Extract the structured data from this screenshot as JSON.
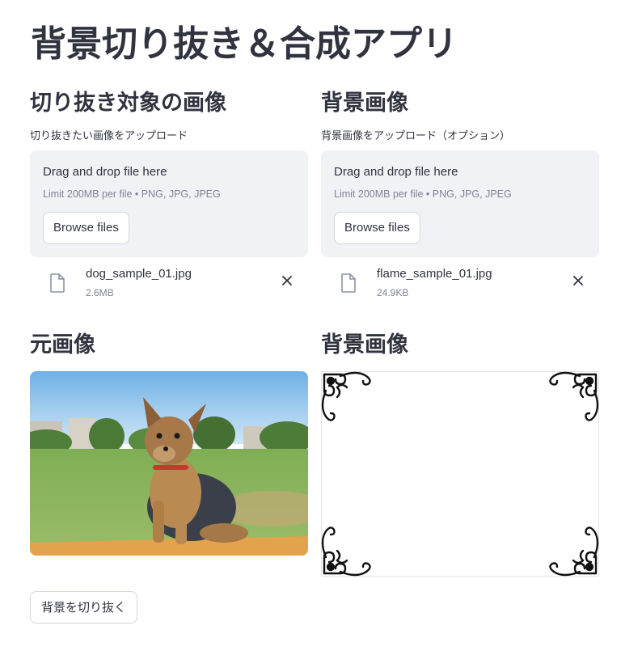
{
  "app": {
    "title": "背景切り抜き＆合成アプリ"
  },
  "cutout": {
    "heading": "切り抜き対象の画像",
    "uploader": {
      "label": "切り抜きたい画像をアップロード",
      "drop_text": "Drag and drop file here",
      "limit_text": "Limit 200MB per file • PNG, JPG, JPEG",
      "browse_label": "Browse files"
    },
    "file": {
      "name": "dog_sample_01.jpg",
      "size": "2.6MB",
      "icon": "file-icon",
      "remove_icon": "close-icon"
    }
  },
  "background": {
    "heading": "背景画像",
    "uploader": {
      "label": "背景画像をアップロード（オプション）",
      "drop_text": "Drag and drop file here",
      "limit_text": "Limit 200MB per file • PNG, JPG, JPEG",
      "browse_label": "Browse files"
    },
    "file": {
      "name": "flame_sample_01.jpg",
      "size": "24.9KB",
      "icon": "file-icon",
      "remove_icon": "close-icon"
    }
  },
  "preview": {
    "original_heading": "元画像",
    "background_heading": "背景画像"
  },
  "actions": {
    "cutout_label": "背景を切り抜く"
  },
  "colors": {
    "text": "#31333f",
    "muted": "#808495",
    "dropzone_bg": "#f0f2f6",
    "border": "#d3d6de"
  }
}
